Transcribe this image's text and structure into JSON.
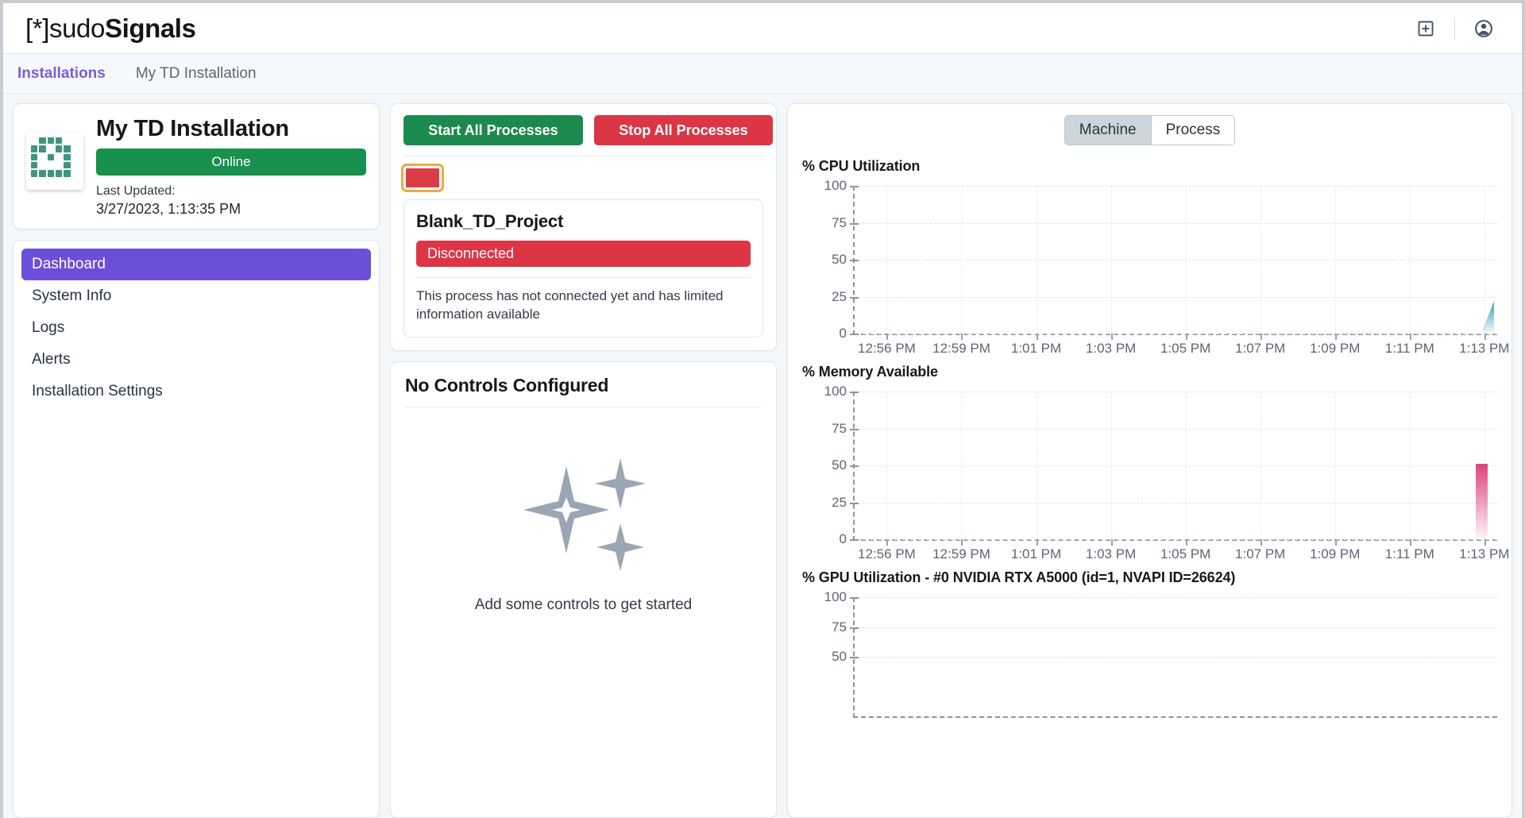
{
  "header": {
    "logo_bracket_open": "[*]",
    "logo_sudo": "sudo",
    "logo_signals": "Signals",
    "add_icon": "add-square-icon",
    "account_icon": "account-circle-icon"
  },
  "tabs": [
    {
      "label": "Installations",
      "active": true
    },
    {
      "label": "My TD Installation",
      "active": false
    }
  ],
  "installation": {
    "title": "My TD Installation",
    "status": "Online",
    "status_color": "#17914d",
    "last_updated_label": "Last Updated:",
    "last_updated_value": "3/27/2023, 1:13:35 PM",
    "logo_icon": "touchdesigner-grid-icon"
  },
  "sidebar": {
    "items": [
      {
        "label": "Dashboard",
        "active": true
      },
      {
        "label": "System Info",
        "active": false
      },
      {
        "label": "Logs",
        "active": false
      },
      {
        "label": "Alerts",
        "active": false
      },
      {
        "label": "Installation Settings",
        "active": false
      }
    ],
    "active_color": "#6c4fd8"
  },
  "processes": {
    "start_all_label": "Start All Processes",
    "stop_all_label": "Stop All Processes",
    "start_color": "#1c8a4e",
    "stop_color": "#dc3545",
    "chip": {
      "name": "process-chip",
      "color": "#dc3c46",
      "selected": true,
      "selection_color": "#f0a845"
    },
    "process": {
      "name": "Blank_TD_Project",
      "status": "Disconnected",
      "status_color": "#dc3545",
      "description": "This process has not connected yet and has limited information available"
    }
  },
  "controls": {
    "title": "No Controls Configured",
    "empty_text": "Add some controls to get started",
    "empty_icon": "sparkles-icon"
  },
  "metrics": {
    "toggle": [
      {
        "label": "Machine",
        "active": true
      },
      {
        "label": "Process",
        "active": false
      }
    ]
  },
  "chart_data": [
    {
      "type": "area",
      "title": "% CPU Utilization",
      "xlabel": "",
      "ylabel": "",
      "ylim": [
        0,
        100
      ],
      "yticks": [
        0,
        25,
        50,
        75,
        100
      ],
      "xticks": [
        "12:56 PM",
        "12:59 PM",
        "1:01 PM",
        "1:03 PM",
        "1:05 PM",
        "1:07 PM",
        "1:09 PM",
        "1:11 PM",
        "1:13 PM"
      ],
      "grid": true,
      "legend": "none",
      "series": [
        {
          "name": "CPU",
          "color": "#2f9fb4",
          "x": [
            "1:12 PM",
            "1:13 PM"
          ],
          "values": [
            0,
            22
          ]
        }
      ]
    },
    {
      "type": "area",
      "title": "% Memory Available",
      "xlabel": "",
      "ylabel": "",
      "ylim": [
        0,
        100
      ],
      "yticks": [
        0,
        25,
        50,
        75,
        100
      ],
      "xticks": [
        "12:56 PM",
        "12:59 PM",
        "1:01 PM",
        "1:03 PM",
        "1:05 PM",
        "1:07 PM",
        "1:09 PM",
        "1:11 PM",
        "1:13 PM"
      ],
      "grid": true,
      "legend": "none",
      "series": [
        {
          "name": "Memory Available",
          "color": "#e0417e",
          "x": [
            "1:13 PM"
          ],
          "values": [
            51
          ]
        }
      ]
    },
    {
      "type": "area",
      "title": "% GPU Utilization - #0 NVIDIA RTX A5000 (id=1, NVAPI ID=26624)",
      "xlabel": "",
      "ylabel": "",
      "ylim": [
        0,
        100
      ],
      "yticks": [
        50,
        75,
        100
      ],
      "xticks": [],
      "grid": true,
      "legend": "none",
      "series": [
        {
          "name": "GPU",
          "color": "#2f9fb4",
          "x": [],
          "values": []
        }
      ]
    }
  ]
}
